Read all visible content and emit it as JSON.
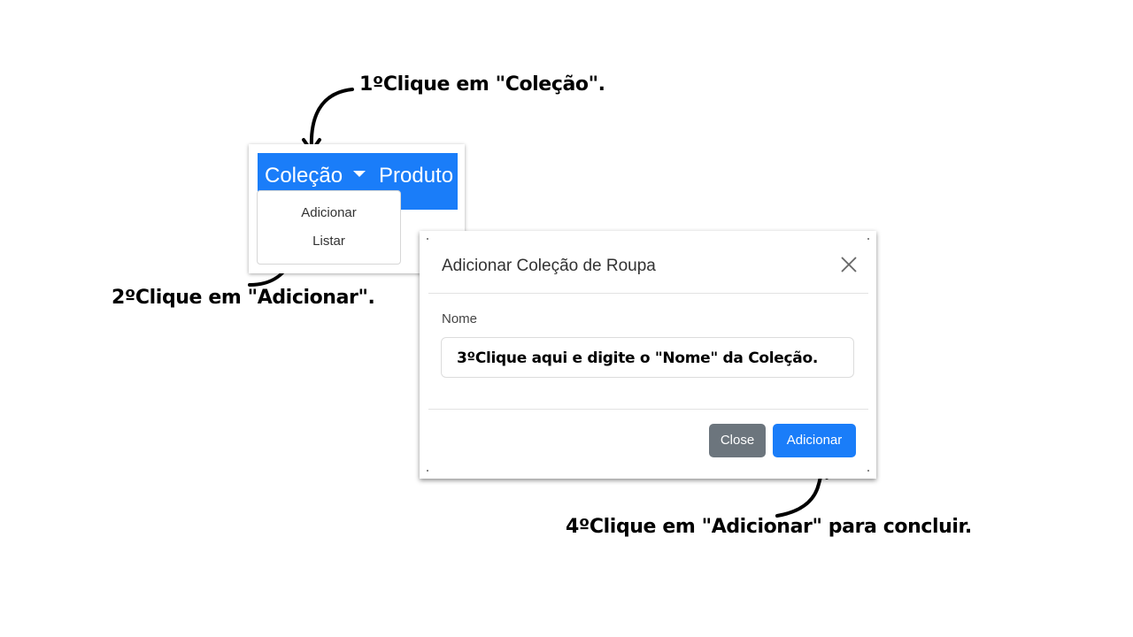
{
  "steps": {
    "step1": "1ºClique em \"Coleção\".",
    "step2": "2ºClique em \"Adicionar\".",
    "step4": "4ºClique em \"Adicionar\" para concluir."
  },
  "navbar": {
    "colecao": "Coleção",
    "produto": "Produto",
    "dropdown_items": [
      "Adicionar",
      "Listar"
    ],
    "color": "#1a7df9"
  },
  "modal": {
    "title": "Adicionar Coleção de Roupa",
    "field_label": "Nome",
    "input_value": "3ºClique aqui e digite o \"Nome\" da Coleção.",
    "close_button": "Close",
    "add_button": "Adicionar",
    "icons": [
      "close-icon"
    ]
  }
}
